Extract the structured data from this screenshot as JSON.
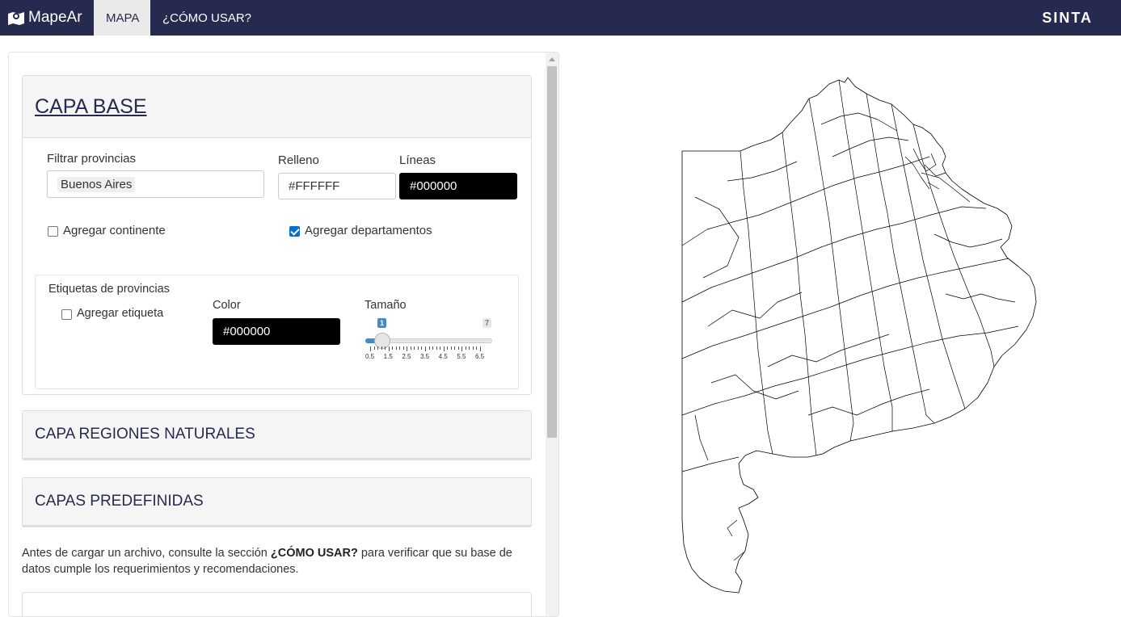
{
  "nav": {
    "brand": "MapeAr",
    "tabs": [
      {
        "label": "MAPA",
        "active": true
      },
      {
        "label": "¿CÓMO USAR?",
        "active": false
      }
    ],
    "right_brand": "SINTA",
    "colors": {
      "navbar": "#262a4f",
      "active_tab": "#eaeaea"
    }
  },
  "base_layer": {
    "title": "CAPA BASE",
    "filter_label": "Filtrar provincias",
    "filter_value": "Buenos Aires",
    "fill_label": "Relleno",
    "fill_value": "#FFFFFF",
    "lines_label": "Líneas",
    "lines_value": "#000000",
    "add_continent_label": "Agregar continente",
    "add_continent_checked": false,
    "add_departments_label": "Agregar departamentos",
    "add_departments_checked": true,
    "labels_section": {
      "title": "Etiquetas de provincias",
      "add_label": "Agregar etiqueta",
      "add_label_checked": false,
      "color_label": "Color",
      "color_value": "#000000",
      "size_label": "Tamaño",
      "size_value": "1",
      "size_max": "7",
      "size_ticks": [
        "0.5",
        "1.5",
        "2.5",
        "3.5",
        "4.5",
        "5.5",
        "6.5"
      ]
    }
  },
  "natural_regions": {
    "title": "CAPA REGIONES NATURALES"
  },
  "predefined": {
    "title": "CAPAS PREDEFINIDAS"
  },
  "note": {
    "before": "Antes de cargar un archivo, consulte la sección ",
    "link": "¿CÓMO USAR?",
    "after": " para verificar que su base de datos cumple los requerimientos y recomendaciones."
  },
  "map": {
    "icon": "buenos-aires-province-map",
    "fill": "#FFFFFF",
    "stroke": "#000000"
  }
}
